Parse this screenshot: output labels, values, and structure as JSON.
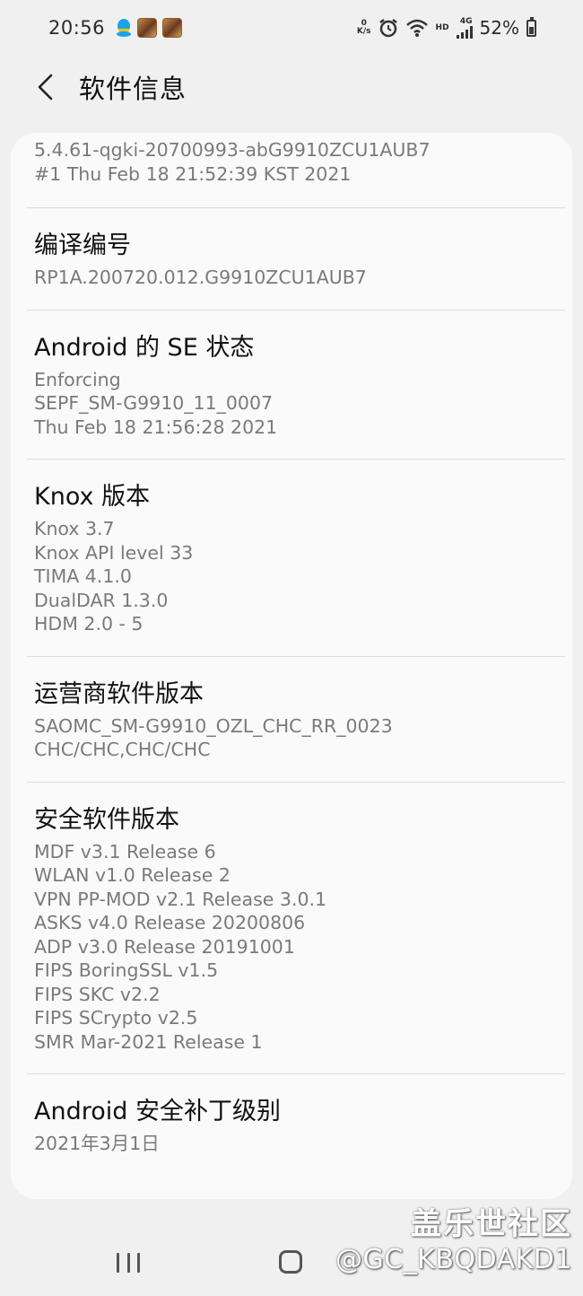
{
  "status_bar": {
    "time": "20:56",
    "net_speed_value": "0",
    "net_speed_unit": "K/s",
    "hd_label": "HD",
    "signal_label": "4G",
    "battery": "52%"
  },
  "header": {
    "title": "软件信息"
  },
  "sections": [
    {
      "title": "",
      "lines": [
        "5.4.61-qgki-20700993-abG9910ZCU1AUB7",
        "#1 Thu Feb 18 21:52:39 KST 2021"
      ]
    },
    {
      "title": "编译编号",
      "lines": [
        "RP1A.200720.012.G9910ZCU1AUB7"
      ]
    },
    {
      "title": "Android 的 SE 状态",
      "lines": [
        "Enforcing",
        "SEPF_SM-G9910_11_0007",
        "Thu Feb 18 21:56:28 2021"
      ]
    },
    {
      "title": "Knox 版本",
      "lines": [
        "Knox 3.7",
        "Knox API level 33",
        "TIMA 4.1.0",
        "DualDAR 1.3.0",
        "HDM 2.0 - 5"
      ]
    },
    {
      "title": "运营商软件版本",
      "lines": [
        "SAOMC_SM-G9910_OZL_CHC_RR_0023",
        "CHC/CHC,CHC/CHC"
      ]
    },
    {
      "title": "安全软件版本",
      "lines": [
        "MDF v3.1 Release 6",
        "WLAN v1.0 Release 2",
        "VPN PP-MOD v2.1 Release 3.0.1",
        "ASKS v4.0 Release 20200806",
        "ADP v3.0 Release 20191001",
        "FIPS BoringSSL v1.5",
        "FIPS SKC v2.2",
        "FIPS SCrypto v2.5",
        "SMR Mar-2021 Release 1"
      ]
    },
    {
      "title": "Android 安全补丁级别",
      "lines": [
        "2021年3月1日"
      ]
    }
  ],
  "watermark": {
    "site": "盖乐世社区",
    "user": "@GC_KBQDAKD1"
  },
  "icons": {
    "back": "chevron-left-icon",
    "recent": "recent-apps-icon",
    "home": "home-icon"
  },
  "colors": {
    "background": "#f0f0f0",
    "card": "#fafafa",
    "title_text": "#111111",
    "secondary_text": "#7a7a7a",
    "divider": "#dcdcdc"
  }
}
